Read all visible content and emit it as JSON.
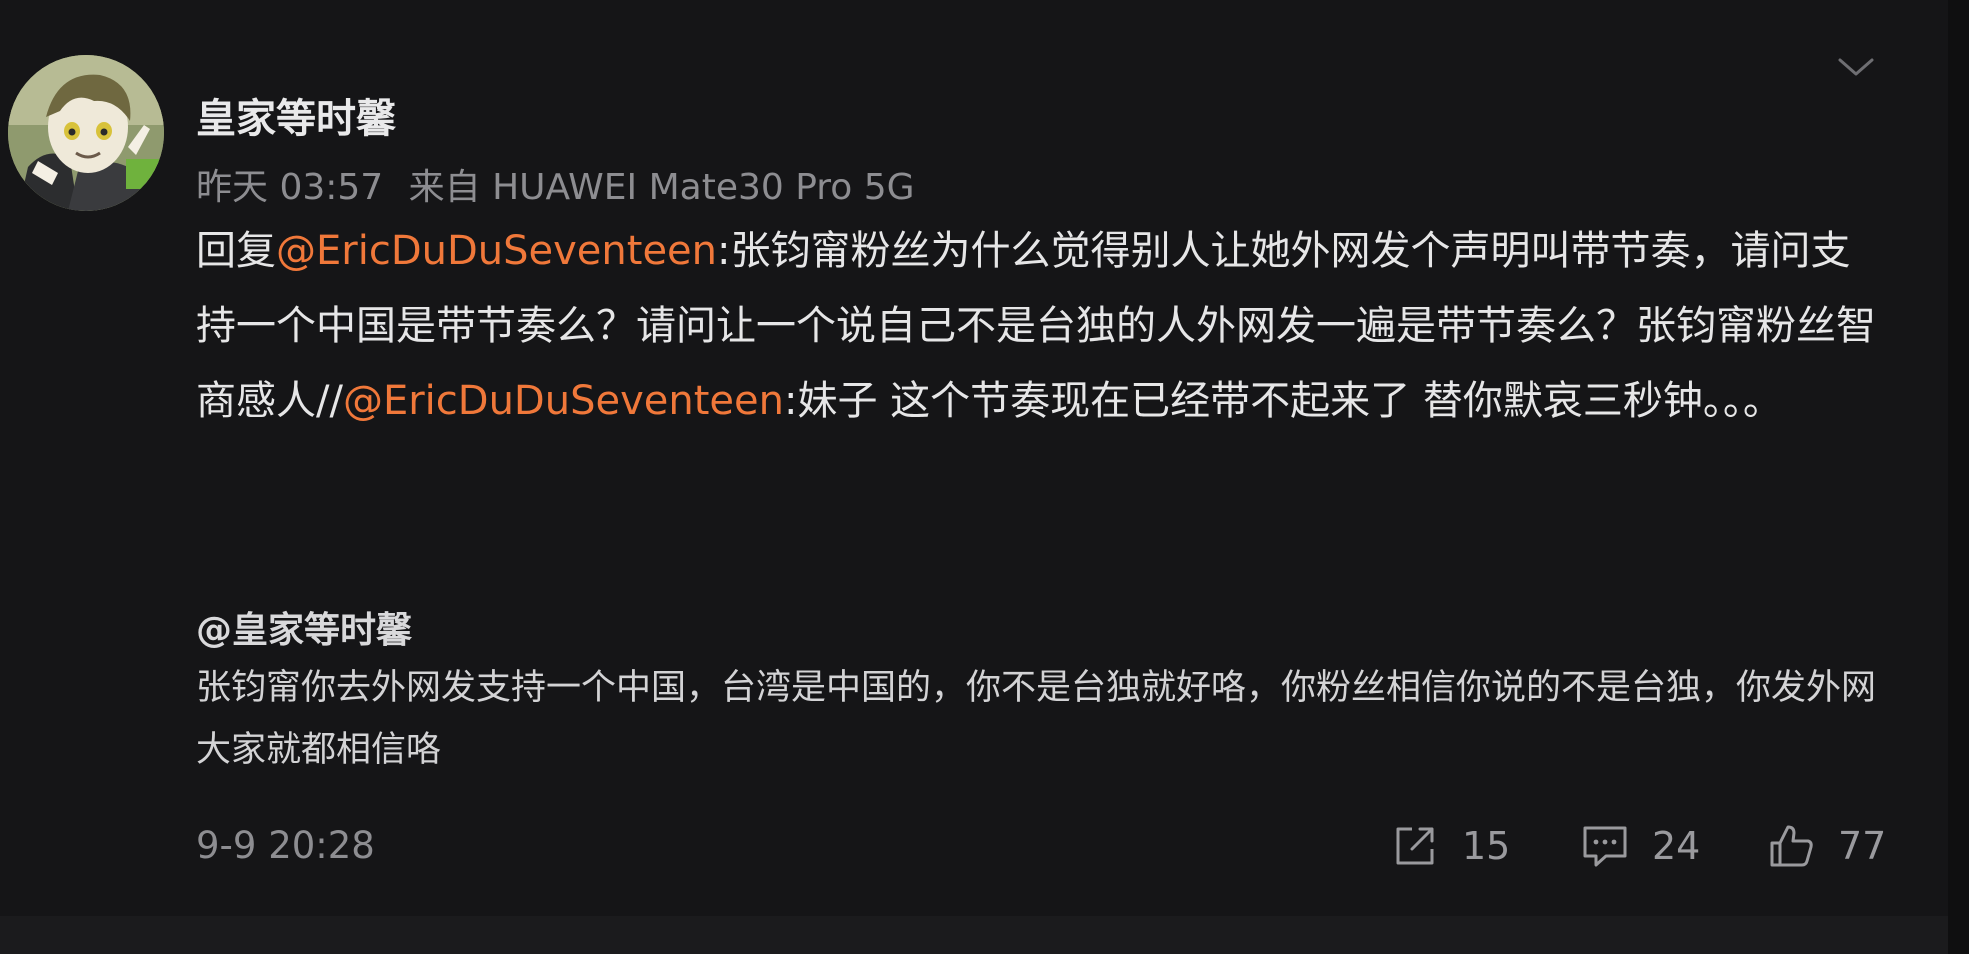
{
  "post": {
    "author": "皇家等时馨",
    "time": "昨天 03:57",
    "source": "来自 HUAWEI Mate30 Pro 5G",
    "body": {
      "prefix": "回复",
      "mention1": "@EricDuDuSeventeen",
      "text1": ":张钧甯粉丝为什么觉得别人让她外网发个声明叫带节奏，请问支持一个中国是带节奏么？请问让一个说自己不是台独的人外网发一遍是带节奏么？张钧甯粉丝智商感人//",
      "mention2": "@EricDuDuSeventeen",
      "text2": ":妹子 这个节奏现在已经带不起来了 替你默哀三秒钟。。。"
    }
  },
  "quoted": {
    "author": "@皇家等时馨",
    "text": "张钧甯你去外网发支持一个中国，台湾是中国的，你不是台独就好咯，你粉丝相信你说的不是台独，你发外网大家就都相信咯",
    "timestamp": "9-9 20:28"
  },
  "actions": {
    "repost": {
      "icon": "share-icon",
      "count": "15"
    },
    "comment": {
      "icon": "comment-icon",
      "count": "24"
    },
    "like": {
      "icon": "thumbs-up-icon",
      "count": "77"
    }
  },
  "menu": {
    "icon": "chevron-down-icon"
  },
  "colors": {
    "background": "#151517",
    "mention": "#f0783a",
    "text": "#e6e6e7",
    "muted": "#8d8d91"
  }
}
